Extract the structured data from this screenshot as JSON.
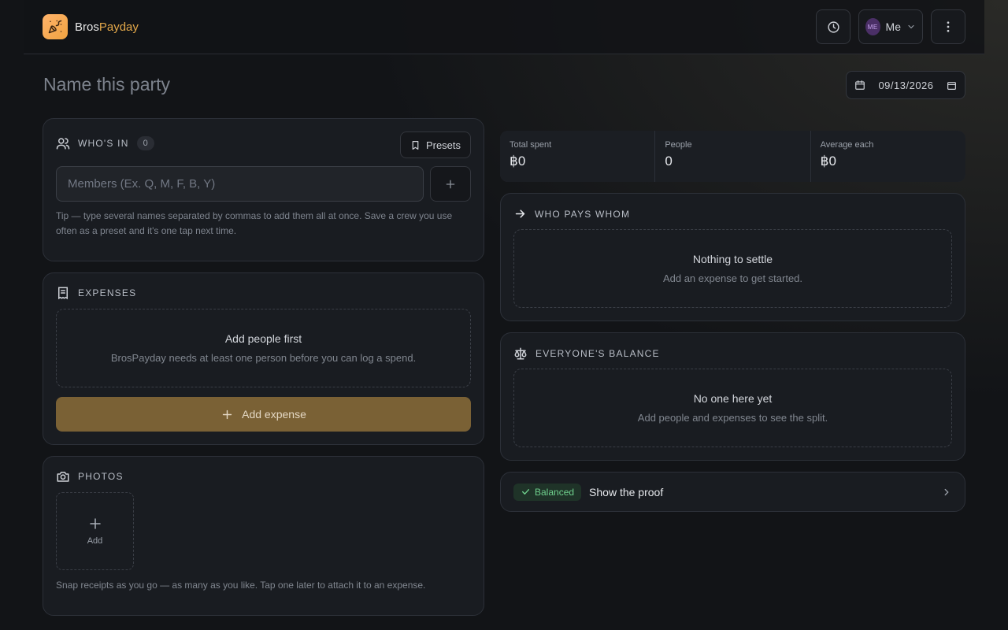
{
  "app": {
    "name_part1": "Bros",
    "name_part2": "Payday"
  },
  "header": {
    "user_label": "Me",
    "avatar_initials": "ME"
  },
  "party": {
    "name_placeholder": "Name this party",
    "date": "09/13/2026"
  },
  "members": {
    "title": "Who's in",
    "count": "0",
    "presets_label": "Presets",
    "input_placeholder": "Members (Ex. Q, M, F, B, Y)",
    "tip": "Tip — type several names separated by commas to add them all at once. Save a crew you use often as a preset and it's one tap next time."
  },
  "expenses": {
    "title": "Expenses",
    "empty_title": "Add people first",
    "empty_sub": "BrosPayday needs at least one person before you can log a spend.",
    "add_label": "Add expense"
  },
  "photos": {
    "title": "Photos",
    "add_label": "Add",
    "tip": "Snap receipts as you go — as many as you like. Tap one later to attach it to an expense."
  },
  "stats": [
    {
      "label": "Total spent",
      "value": "฿0"
    },
    {
      "label": "People",
      "value": "0"
    },
    {
      "label": "Average each",
      "value": "฿0"
    }
  ],
  "settle": {
    "title": "Who pays whom",
    "empty_title": "Nothing to settle",
    "empty_sub": "Add an expense to get started."
  },
  "balance": {
    "title": "Everyone's balance",
    "empty_title": "No one here yet",
    "empty_sub": "Add people and expenses to see the split."
  },
  "proof": {
    "badge": "Balanced",
    "label": "Show the proof"
  },
  "colors": {
    "accent": "#e3a84a",
    "button_gold": "#7a6135",
    "success": "#6fd08d"
  }
}
